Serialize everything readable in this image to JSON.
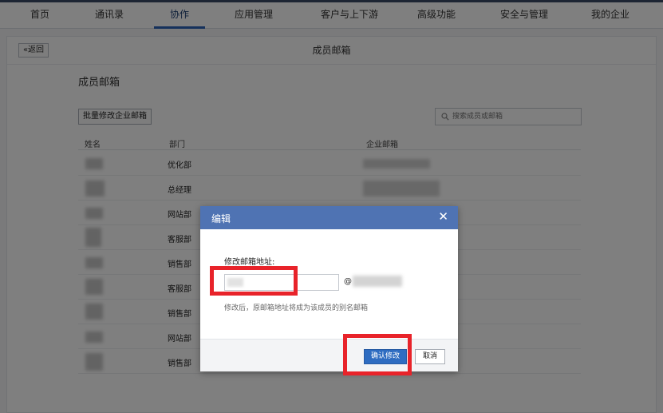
{
  "nav": {
    "items": [
      "首页",
      "通讯录",
      "协作",
      "应用管理",
      "客户与上下游",
      "高级功能",
      "安全与管理",
      "我的企业"
    ],
    "active_index": 2
  },
  "header": {
    "back_label": "«返回",
    "title": "成员邮箱"
  },
  "main": {
    "section_title": "成员邮箱",
    "batch_button": "批量修改企业邮箱",
    "search_placeholder": "搜索成员或邮箱",
    "table": {
      "columns": [
        "姓名",
        "部门",
        "企业邮箱"
      ],
      "rows": [
        {
          "department": "优化部"
        },
        {
          "department": "总经理"
        },
        {
          "department": "网站部"
        },
        {
          "department": "客服部"
        },
        {
          "department": "销售部"
        },
        {
          "department": "客服部"
        },
        {
          "department": "销售部"
        },
        {
          "department": "网站部"
        },
        {
          "department": "销售部"
        }
      ]
    }
  },
  "dialog": {
    "title": "编辑",
    "close_icon": "close-icon",
    "field_label": "修改邮箱地址:",
    "email_value": "",
    "at_sign": "@",
    "hint": "修改后，原邮箱地址将成为该成员的别名邮箱",
    "confirm_label": "确认修改",
    "cancel_label": "取消"
  },
  "colors": {
    "accent": "#2e6cc1",
    "dialog_header": "#4f73b3",
    "highlight": "#e8232a",
    "nav_dark": "#3b4a66"
  }
}
